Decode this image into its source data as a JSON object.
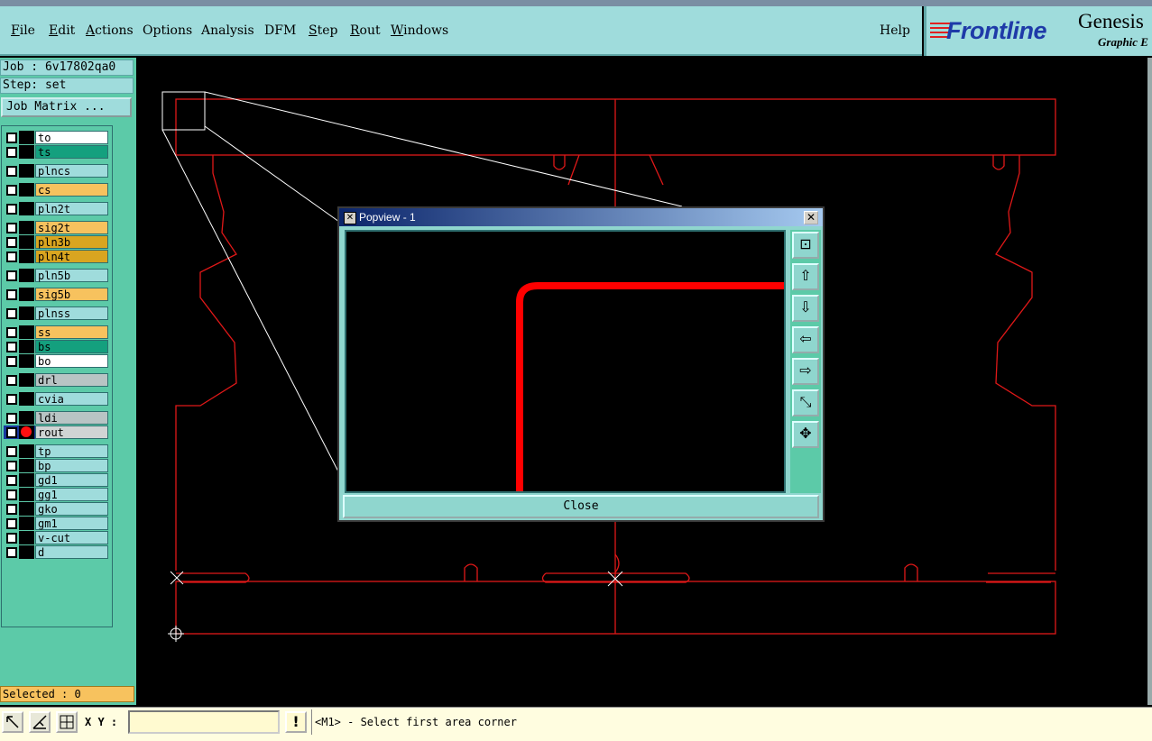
{
  "menubar": {
    "items": [
      {
        "label": "File",
        "underline": "F"
      },
      {
        "label": "Edit",
        "underline": "E"
      },
      {
        "label": "Actions",
        "underline": "A"
      },
      {
        "label": "Options",
        "underline": ""
      },
      {
        "label": "Analysis",
        "underline": ""
      },
      {
        "label": "DFM",
        "underline": ""
      },
      {
        "label": "Step",
        "underline": "S"
      },
      {
        "label": "Rout",
        "underline": "R"
      },
      {
        "label": "Windows",
        "underline": "W"
      }
    ],
    "help": "Help"
  },
  "logo": {
    "brand": "Frontline",
    "product": "Genesis",
    "subtitle": "Graphic E"
  },
  "sidebar": {
    "job_line": "Job : 6v17802qa0",
    "step_line": "Step: set",
    "job_matrix_button": "Job Matrix ...",
    "layers": [
      {
        "name": "to",
        "color": "#ffffff"
      },
      {
        "name": "ts",
        "color": "#14a07e"
      },
      {
        "name": "plncs",
        "color": "#9fdcdc"
      },
      {
        "name": "cs",
        "color": "#f7c25e"
      },
      {
        "name": "pln2t",
        "color": "#9fdcdc"
      },
      {
        "name": "sig2t",
        "color": "#f7c25e"
      },
      {
        "name": "pln3b",
        "color": "#d9a520"
      },
      {
        "name": "pln4t",
        "color": "#d9a520"
      },
      {
        "name": "pln5b",
        "color": "#9fdcdc"
      },
      {
        "name": "sig5b",
        "color": "#f7c25e"
      },
      {
        "name": "plnss",
        "color": "#9fdcdc"
      },
      {
        "name": "ss",
        "color": "#f7c25e"
      },
      {
        "name": "bs",
        "color": "#14a07e"
      },
      {
        "name": "bo",
        "color": "#ffffff"
      },
      {
        "name": "drl",
        "color": "#b8c4c4"
      },
      {
        "name": "cvia",
        "color": "#9fdcdc"
      },
      {
        "name": "ldi",
        "color": "#b8c4c4"
      },
      {
        "name": "rout",
        "color": "#d0d4d4",
        "active": true
      },
      {
        "name": "tp",
        "color": "#9fdcdc"
      },
      {
        "name": "bp",
        "color": "#9fdcdc"
      },
      {
        "name": "gd1",
        "color": "#9fdcdc"
      },
      {
        "name": "gg1",
        "color": "#9fdcdc"
      },
      {
        "name": "gko",
        "color": "#9fdcdc"
      },
      {
        "name": "gm1",
        "color": "#9fdcdc"
      },
      {
        "name": "v-cut",
        "color": "#9fdcdc"
      },
      {
        "name": "d",
        "color": "#9fdcdc"
      }
    ],
    "selected_line": "Selected : 0"
  },
  "popview": {
    "title": "Popview - 1",
    "close_button": "Close",
    "tools": [
      "zoom-fit-icon",
      "pan-up-icon",
      "pan-down-icon",
      "pan-left-icon",
      "pan-right-icon",
      "zoom-out-icon",
      "zoom-in-icon"
    ]
  },
  "bottombar": {
    "xy_label": "X Y :",
    "xy_value": "",
    "status": "<M1> - Select first area corner",
    "warn": "!"
  },
  "colors": {
    "menubar": "#9fdcdc",
    "panel": "#5ccaa8",
    "outline": "#e01818",
    "selected_bg": "#f7c25e"
  }
}
